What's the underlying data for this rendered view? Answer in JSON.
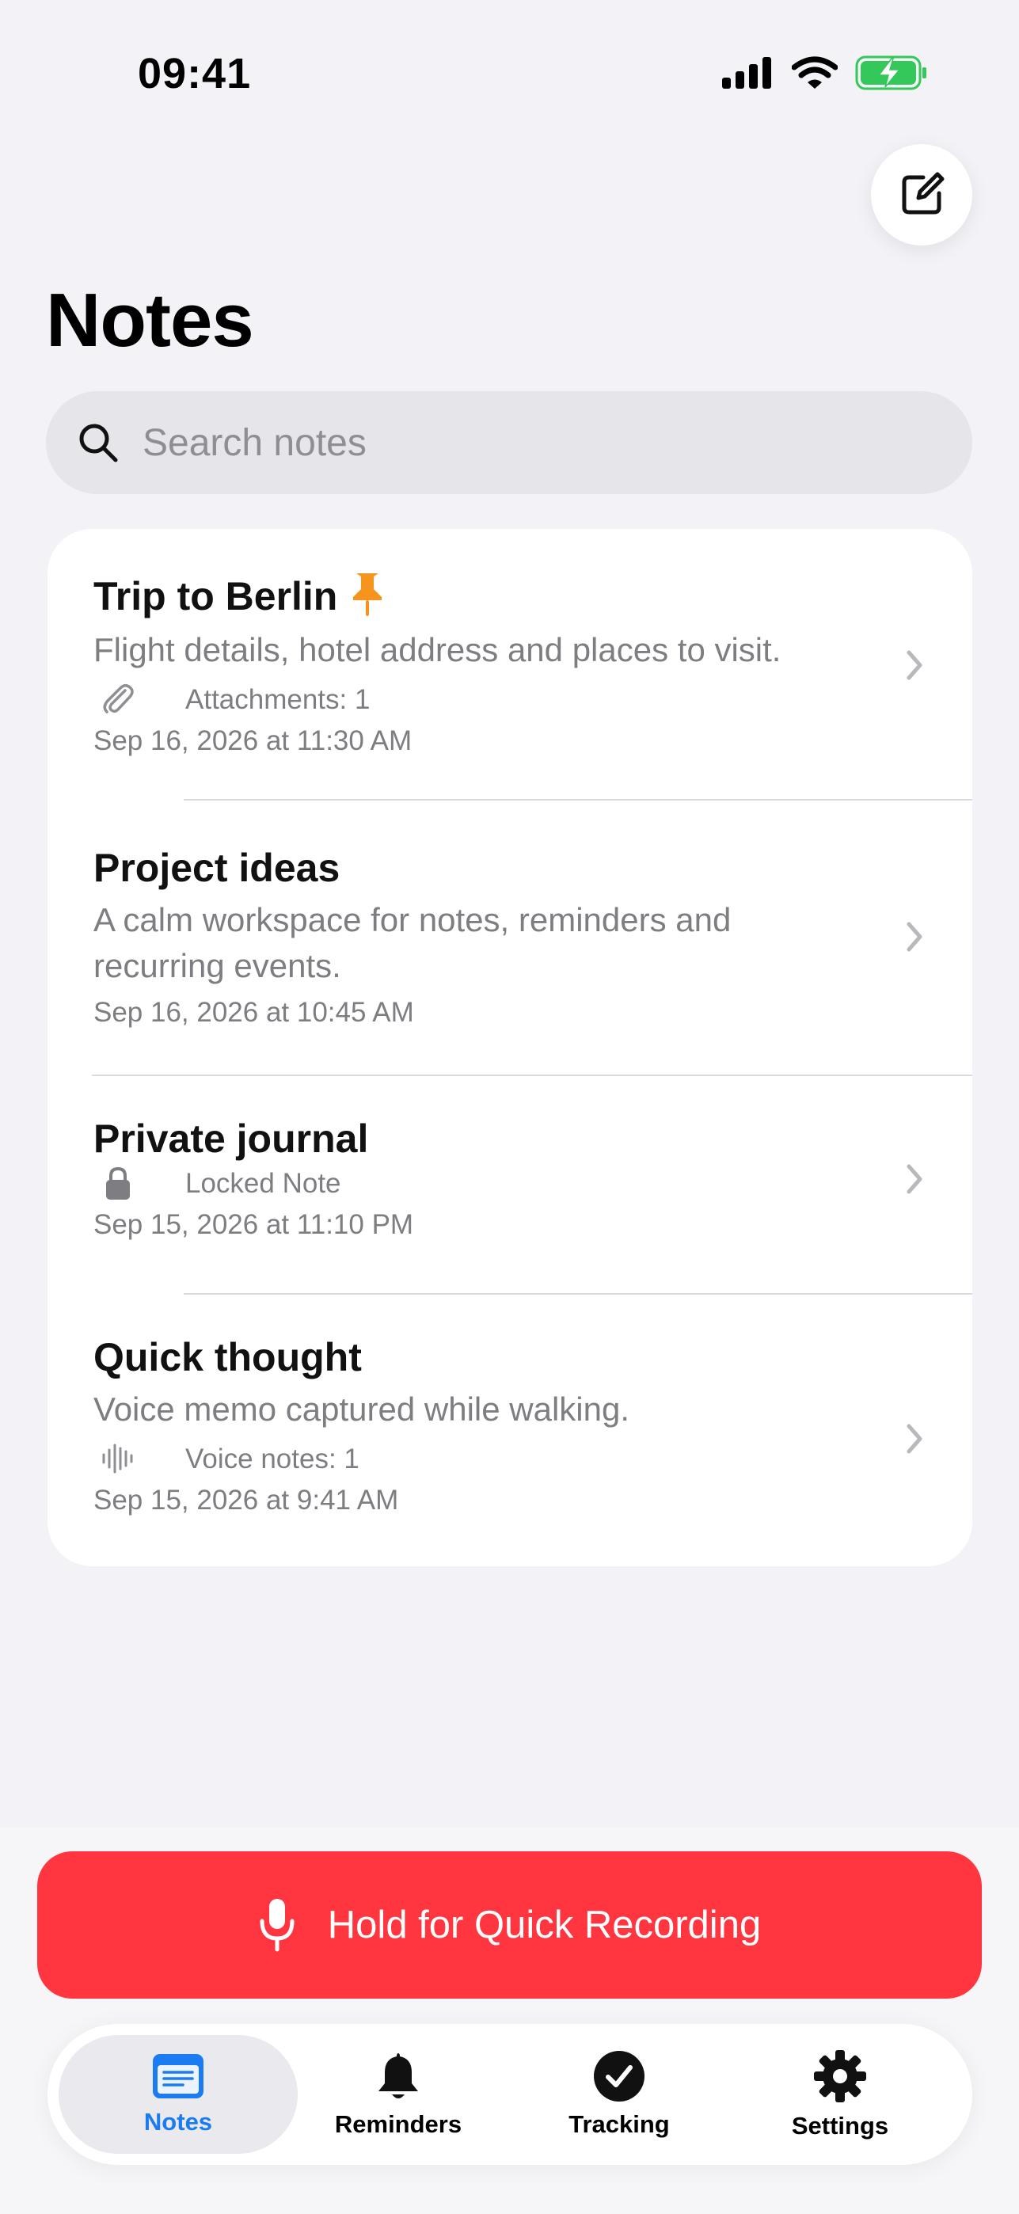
{
  "status_bar": {
    "time": "09:41"
  },
  "header": {
    "title": "Notes"
  },
  "search": {
    "placeholder": "Search notes"
  },
  "notes": [
    {
      "title": "Trip to Berlin",
      "pinned": true,
      "preview": "Flight details, hotel address and places to visit.",
      "meta_icon": "paperclip-icon",
      "meta": "Attachments: 1",
      "date": "Sep 16, 2026 at 11:30 AM"
    },
    {
      "title": "Project ideas",
      "preview": "A calm workspace for notes, reminders and recurring events.",
      "date": "Sep 16, 2026 at 10:45 AM"
    },
    {
      "title": "Private journal",
      "meta_icon": "lock-icon",
      "meta": "Locked Note",
      "date": "Sep 15, 2026 at 11:10 PM"
    },
    {
      "title": "Quick thought",
      "preview": "Voice memo captured while walking.",
      "meta_icon": "waveform-icon",
      "meta": "Voice notes: 1",
      "date": "Sep 15, 2026 at 9:41 AM"
    }
  ],
  "record_button": {
    "label": "Hold for Quick Recording"
  },
  "tabs": [
    {
      "label": "Notes",
      "icon": "notes-icon",
      "active": true
    },
    {
      "label": "Reminders",
      "icon": "bell-icon"
    },
    {
      "label": "Tracking",
      "icon": "checkmark-circle-icon"
    },
    {
      "label": "Settings",
      "icon": "gear-icon"
    }
  ],
  "colors": {
    "accent": "#1A7CF0",
    "record": "#FF363F",
    "pin": "#F7941D",
    "battery": "#34C759",
    "background": "#F2F2F7"
  }
}
